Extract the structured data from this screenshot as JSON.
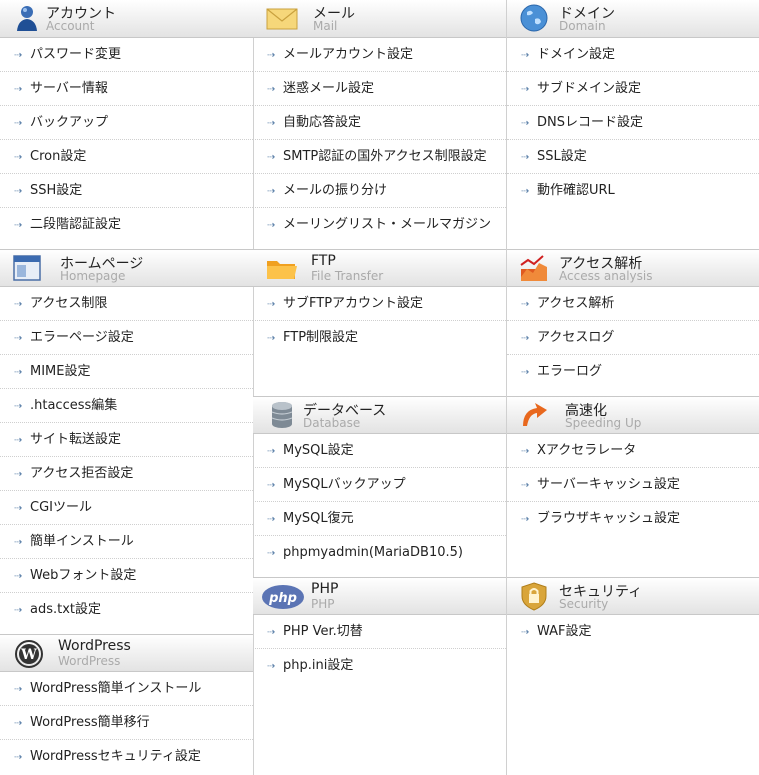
{
  "columns": [
    {
      "sections": [
        {
          "title": "アカウント",
          "subtitle": "Account",
          "icon": "account-icon",
          "items": [
            "パスワード変更",
            "サーバー情報",
            "バックアップ",
            "Cron設定",
            "SSH設定",
            "二段階認証設定"
          ]
        },
        {
          "title": "ホームページ",
          "subtitle": "Homepage",
          "icon": "homepage-icon",
          "items": [
            "アクセス制限",
            "エラーページ設定",
            "MIME設定",
            ".htaccess編集",
            "サイト転送設定",
            "アクセス拒否設定",
            "CGIツール",
            "簡単インストール",
            "Webフォント設定",
            "ads.txt設定"
          ]
        },
        {
          "title": "WordPress",
          "subtitle": "WordPress",
          "icon": "wordpress-icon",
          "items": [
            "WordPress簡単インストール",
            "WordPress簡単移行",
            "WordPressセキュリティ設定"
          ]
        }
      ]
    },
    {
      "sections": [
        {
          "title": "メール",
          "subtitle": "Mail",
          "icon": "mail-icon",
          "items": [
            "メールアカウント設定",
            "迷惑メール設定",
            "自動応答設定",
            "SMTP認証の国外アクセス制限設定",
            "メールの振り分け",
            "メーリングリスト・メールマガジン"
          ]
        },
        {
          "title": "FTP",
          "subtitle": "File Transfer",
          "icon": "folder-icon",
          "items": [
            "サブFTPアカウント設定",
            "FTP制限設定"
          ]
        },
        {
          "title": "データベース",
          "subtitle": "Database",
          "icon": "database-icon",
          "items": [
            "MySQL設定",
            "MySQLバックアップ",
            "MySQL復元",
            "phpmyadmin(MariaDB10.5)"
          ]
        },
        {
          "title": "PHP",
          "subtitle": "PHP",
          "icon": "php-icon",
          "items": [
            "PHP Ver.切替",
            "php.ini設定"
          ]
        }
      ]
    },
    {
      "sections": [
        {
          "title": "ドメイン",
          "subtitle": "Domain",
          "icon": "globe-icon",
          "items": [
            "ドメイン設定",
            "サブドメイン設定",
            "DNSレコード設定",
            "SSL設定",
            "動作確認URL"
          ]
        },
        {
          "title": "アクセス解析",
          "subtitle": "Access analysis",
          "icon": "analytics-icon",
          "items": [
            "アクセス解析",
            "アクセスログ",
            "エラーログ"
          ]
        },
        {
          "title": "高速化",
          "subtitle": "Speeding Up",
          "icon": "speed-icon",
          "items": [
            "Xアクセラレータ",
            "サーバーキャッシュ設定",
            "ブラウザキャッシュ設定"
          ]
        },
        {
          "title": "セキュリティ",
          "subtitle": "Security",
          "icon": "lock-icon",
          "items": [
            "WAF設定"
          ]
        }
      ]
    }
  ]
}
